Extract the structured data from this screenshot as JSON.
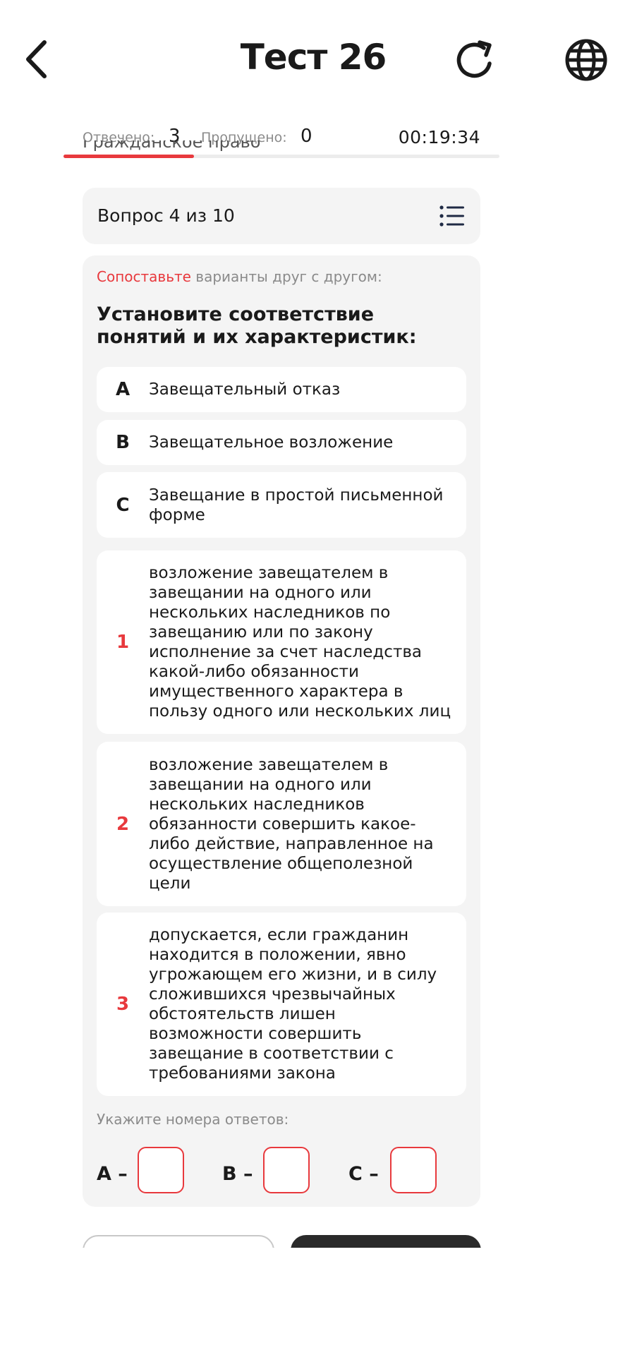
{
  "header": {
    "title": "Тест 26",
    "back_icon": "chevron-left-icon",
    "refresh_icon": "refresh-icon",
    "globe_icon": "globe-icon"
  },
  "stats": {
    "answered_label": "Отвечено:",
    "answered_value": "3",
    "skipped_label": "Пропущено:",
    "skipped_value": "0",
    "timer": "00:19:34"
  },
  "peek_text": "Гражданское право",
  "progress": {
    "fraction": 0.3,
    "color": "#e8393d"
  },
  "question_header": {
    "counter": "Вопрос 4 из 10",
    "list_icon": "list-icon"
  },
  "card": {
    "instruction_accent": "Сопоставьте",
    "instruction_rest": " варианты друг с другом:",
    "question": "Установите соответствие понятий и их характеристик:",
    "options": [
      {
        "key": "A",
        "text": "Завещательный отказ"
      },
      {
        "key": "B",
        "text": "Завещательное возложение"
      },
      {
        "key": "C",
        "text": "Завещание в простой письменной форме"
      }
    ],
    "answers": [
      {
        "key": "1",
        "text": "возложение завещателем в завещании на одного или нескольких наследников по завещанию или по закону исполнение за счет наследства какой-либо обязанности имущественного характера в пользу одного или нескольких лиц"
      },
      {
        "key": "2",
        "text": "возложение завещателем в завещании на одного или нескольких наследников обязанности совершить какое-либо действие, направленное на осуществление общеполезной цели"
      },
      {
        "key": "3",
        "text": "допускается, если гражданин находится в положении, явно угрожающем его жизни, и в силу сложившихся чрезвычайных обстоятельств лишен возможности совершить завещание в соответствии с требованиями закона"
      }
    ],
    "answer_hint": "Укажите номера ответов:",
    "answer_labels": [
      "A –",
      "B –",
      "C –"
    ]
  },
  "colors": {
    "accent": "#e8393d",
    "card_bg": "#f4f4f4",
    "dark_button": "#2a2a2a"
  }
}
